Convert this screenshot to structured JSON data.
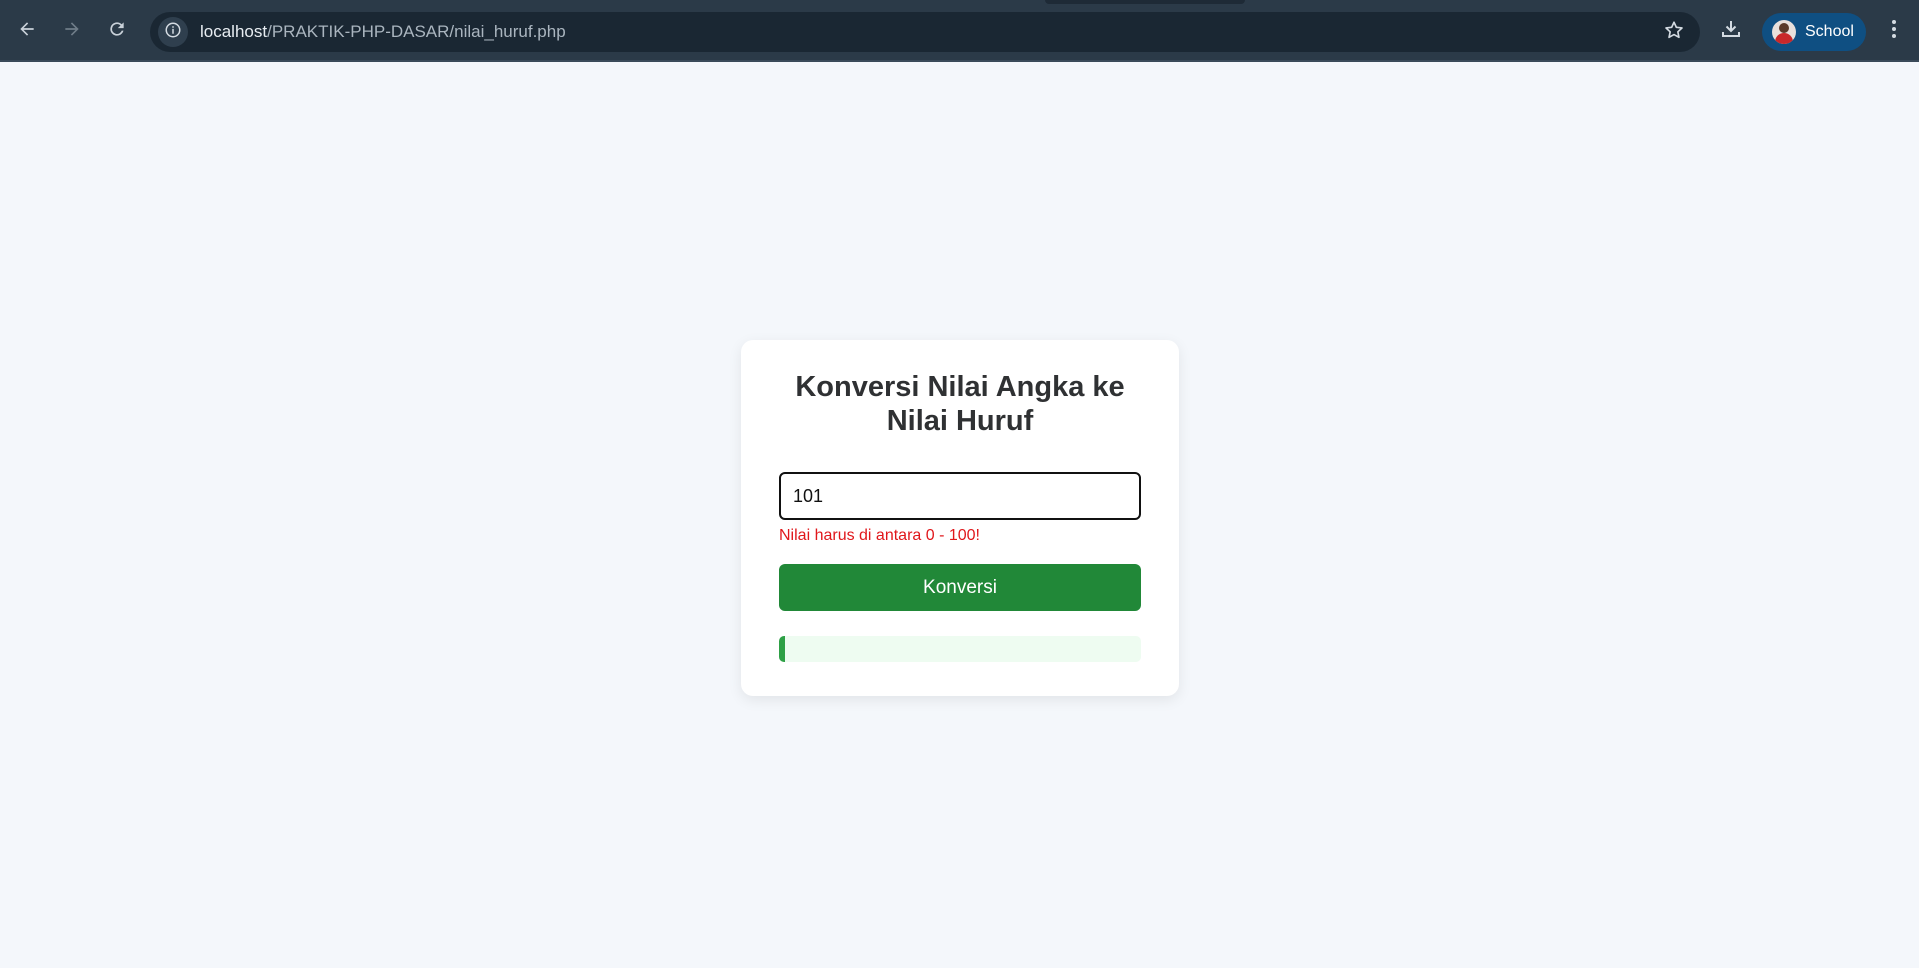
{
  "browser": {
    "url_host": "localhost",
    "url_path": "/PRAKTIK-PHP-DASAR/nilai_huruf.php",
    "profile_name": "School",
    "icons": {
      "back": "arrow-left-icon",
      "forward": "arrow-right-icon",
      "reload": "reload-icon",
      "site_info": "info-icon",
      "bookmark": "star-icon",
      "download": "download-icon",
      "menu": "kebab-menu-icon"
    },
    "colors": {
      "toolbar": "#2b3a48",
      "omnibox": "#1a2733",
      "profile_chip": "#0f4f82"
    }
  },
  "page": {
    "title": "Konversi Nilai Angka ke Nilai Huruf",
    "input_value": "101",
    "error_message": "Nilai harus di antara 0 - 100!",
    "button_label": "Konversi",
    "result_text": "",
    "colors": {
      "background": "#f4f7fb",
      "button": "#218838",
      "error": "#e0171b",
      "result_background": "#eefcf1",
      "result_accent": "#2ea046"
    }
  }
}
